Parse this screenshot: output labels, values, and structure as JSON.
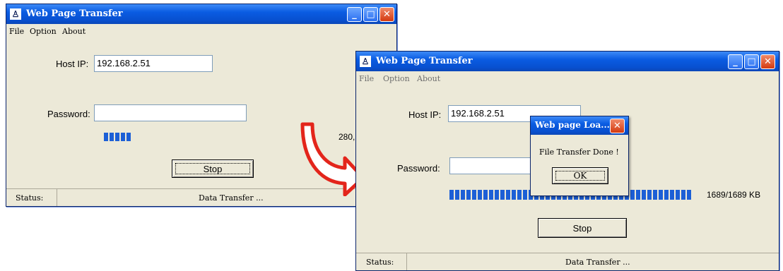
{
  "window1": {
    "title": "Web Page Transfer",
    "app_icon": "transfer-tower-icon",
    "menu": [
      "File",
      "Option",
      "About"
    ],
    "host_ip_label": "Host IP:",
    "host_ip_value": "192.168.2.51",
    "password_label": "Password:",
    "password_value": "",
    "progress_text": "280,",
    "progress_segments": 5,
    "stop_label": "Stop",
    "status_label": "Status:",
    "status_text": "Data Transfer ..."
  },
  "window2": {
    "title": "Web Page Transfer",
    "app_icon": "transfer-tower-icon",
    "menu": [
      "File",
      "Option",
      "About"
    ],
    "host_ip_label": "Host IP:",
    "host_ip_value": "192.168.2.51",
    "password_label": "Password:",
    "password_value": "",
    "progress_text": "1689/1689 KB",
    "progress_fraction": 1.0,
    "stop_label": "Stop",
    "status_label": "Status:",
    "status_text": "Data Transfer ..."
  },
  "dialog": {
    "title": "Web page Loa...",
    "message": "File Transfer Done !",
    "ok_label": "OK"
  },
  "arrow": {
    "color": "#e3251b",
    "icon": "curved-arrow-icon"
  },
  "colors": {
    "titlebar": "#0a5ce2",
    "progress": "#1c5fd6",
    "close_button": "#d43a10"
  }
}
